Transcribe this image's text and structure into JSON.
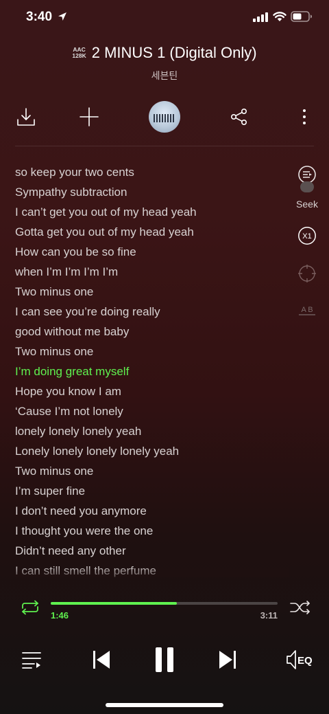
{
  "status_bar": {
    "time": "3:40"
  },
  "header": {
    "quality": {
      "codec": "AAC",
      "bitrate": "128K"
    },
    "title": "2 MINUS 1 (Digital Only)",
    "artist": "세븐틴"
  },
  "toolbar": {
    "icons": [
      "download-icon",
      "add-icon",
      "album-art",
      "share-icon",
      "more-icon"
    ]
  },
  "lyrics": {
    "current_index": 10,
    "lines": [
      "so keep your two cents",
      "Sympathy subtraction",
      "I can’t get you out of my head yeah",
      "Gotta get you out of my head yeah",
      "How can you be so fine",
      "when I’m I’m I’m I’m",
      "Two minus one",
      "I can see you’re doing really",
      "good without me baby",
      "Two minus one",
      "I’m doing great myself",
      "Hope you know I am",
      "‘Cause I’m not lonely",
      "lonely lonely lonely yeah",
      "Lonely lonely lonely lonely yeah",
      "Two minus one",
      "I’m super fine",
      "I don’t need you anymore",
      "I thought you were the one",
      "Didn’t need any other",
      "I can still smell the perfume"
    ]
  },
  "side_controls": {
    "seek_label": "Seek",
    "speed_label": "X1",
    "ab_label": "A B"
  },
  "playback": {
    "current_time": "1:46",
    "duration": "3:11",
    "progress_fraction": 0.555
  },
  "colors": {
    "accent": "#5ff14f",
    "background_top": "#3a1618",
    "background_bottom": "#151212"
  },
  "controls": {
    "eq_label": "EQ",
    "icons": [
      "repeat-icon",
      "shuffle-icon",
      "playlist-icon",
      "previous-icon",
      "pause-icon",
      "next-icon",
      "eq-icon"
    ]
  }
}
